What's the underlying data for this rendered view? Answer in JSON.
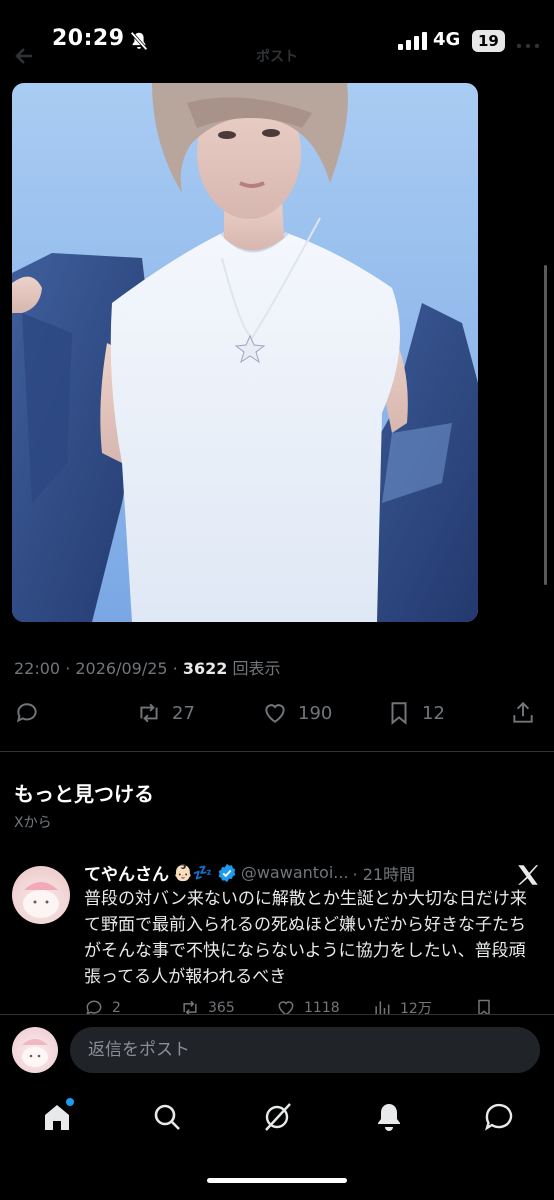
{
  "status_bar": {
    "time": "20:29",
    "network": "4G",
    "battery": "19"
  },
  "header": {
    "title": "ポスト"
  },
  "post": {
    "meta_prefix": "22:00 · 2026/09/25 · ",
    "views_count": "3622",
    "views_label": "回表示",
    "actions": {
      "retweets": "27",
      "likes": "190",
      "bookmarks": "12"
    }
  },
  "discover": {
    "title": "もっと見つける",
    "subtitle": "Xから"
  },
  "tweet": {
    "display_name": "てやんさん",
    "emoji": "👶🏻💤",
    "handle": "@wawantoi...",
    "time": "· 21時間",
    "body": "普段の対バン来ないのに解散とか生誕とか大切な日だけ来て野面で最前入られるの死ぬほど嫌いだから好きな子たちがそんな事で不快にならないように協力をしたい、普段頑張ってる人が報われるべき",
    "actions": {
      "replies": "2",
      "retweets": "365",
      "likes": "1118",
      "views": "12万"
    }
  },
  "reply_bar": {
    "placeholder": "返信をポスト"
  },
  "colors": {
    "background": "#000000",
    "accent": "#1d9bf0",
    "muted": "#71767b"
  },
  "icons": [
    "bell-slash-icon",
    "signal-icon",
    "back-arrow-icon",
    "more-icon",
    "reply-icon",
    "retweet-icon",
    "like-icon",
    "bookmark-icon",
    "share-icon",
    "verified-icon",
    "x-logo-icon",
    "home-icon",
    "search-icon",
    "grok-icon",
    "notifications-icon",
    "messages-icon"
  ]
}
